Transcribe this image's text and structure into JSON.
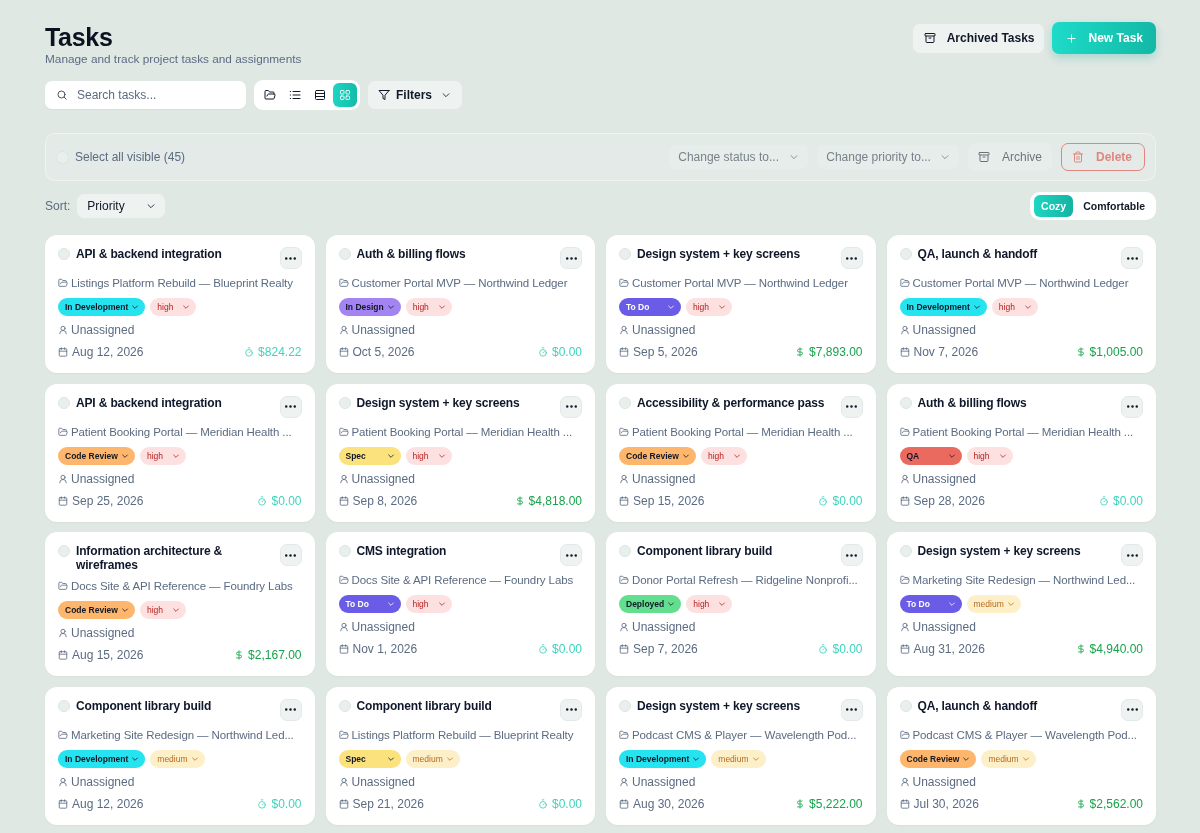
{
  "header": {
    "title": "Tasks",
    "subtitle": "Manage and track project tasks and assignments"
  },
  "header_actions": [
    {
      "label": "Archived Tasks",
      "kind": "secondary"
    },
    {
      "label": "New Task",
      "kind": "primary"
    }
  ],
  "toolbar": {
    "search": {
      "placeholder": "Search tasks..."
    },
    "view_modes": [
      {
        "selected": false
      },
      {
        "selected": false
      },
      {
        "selected": false
      },
      {
        "selected": true
      }
    ],
    "filters_label": "Filters"
  },
  "bulk_actions": {
    "select_all": {
      "label": "Select all visible (45)",
      "checked": false
    },
    "status_select": {
      "label": "Change status to...",
      "disabled": true
    },
    "priority_select": {
      "label": "Change priority to...",
      "disabled": true
    },
    "archive": {
      "label": "Archive",
      "disabled": true
    },
    "delete": {
      "label": "Delete",
      "disabled": true
    }
  },
  "sort": {
    "label": "Sort:",
    "value": "Priority"
  },
  "density": [
    {
      "label": "Cozy",
      "selected": true
    },
    {
      "label": "Comfortable",
      "selected": false
    }
  ],
  "tasks": [
    {
      "title": "API & backend integration",
      "checked": false,
      "project": "Listings Platform Rebuild — Blueprint Realty",
      "status": {
        "label": "In Development",
        "color": "#25e3ef"
      },
      "priority": {
        "label": "high",
        "color": "#fde1e1"
      },
      "assignee": "Unassigned",
      "due": "Aug 12, 2026",
      "amount": {
        "kind": "timer",
        "value": "$824.22"
      }
    },
    {
      "title": "Auth & billing flows",
      "checked": false,
      "project": "Customer Portal MVP — Northwind Ledger",
      "status": {
        "label": "In Design",
        "color": "#a384f2"
      },
      "priority": {
        "label": "high",
        "color": "#fde1e1"
      },
      "assignee": "Unassigned",
      "due": "Oct 5, 2026",
      "amount": {
        "kind": "timer",
        "value": "$0.00"
      }
    },
    {
      "title": "Design system + key screens",
      "checked": false,
      "project": "Customer Portal MVP — Northwind Ledger",
      "status": {
        "label": "To Do",
        "color": "#6b5ce7"
      },
      "priority": {
        "label": "high",
        "color": "#fde1e1"
      },
      "assignee": "Unassigned",
      "due": "Sep 5, 2026",
      "amount": {
        "kind": "budget",
        "value": "$7,893.00"
      }
    },
    {
      "title": "QA, launch & handoff",
      "checked": false,
      "project": "Customer Portal MVP — Northwind Ledger",
      "status": {
        "label": "In Development",
        "color": "#25e3ef"
      },
      "priority": {
        "label": "high",
        "color": "#fde1e1"
      },
      "assignee": "Unassigned",
      "due": "Nov 7, 2026",
      "amount": {
        "kind": "budget",
        "value": "$1,005.00"
      }
    },
    {
      "title": "API & backend integration",
      "checked": false,
      "project": "Patient Booking Portal — Meridian Health ...",
      "status": {
        "label": "Code Review",
        "color": "#fdb66b"
      },
      "priority": {
        "label": "high",
        "color": "#fde1e1"
      },
      "assignee": "Unassigned",
      "due": "Sep 25, 2026",
      "amount": {
        "kind": "timer",
        "value": "$0.00"
      }
    },
    {
      "title": "Design system + key screens",
      "checked": false,
      "project": "Patient Booking Portal — Meridian Health ...",
      "status": {
        "label": "Spec",
        "color": "#fbe27c"
      },
      "priority": {
        "label": "high",
        "color": "#fde1e1"
      },
      "assignee": "Unassigned",
      "due": "Sep 8, 2026",
      "amount": {
        "kind": "budget",
        "value": "$4,818.00"
      }
    },
    {
      "title": "Accessibility & performance pass",
      "checked": false,
      "project": "Patient Booking Portal — Meridian Health ...",
      "status": {
        "label": "Code Review",
        "color": "#fdb66b"
      },
      "priority": {
        "label": "high",
        "color": "#fde1e1"
      },
      "assignee": "Unassigned",
      "due": "Sep 15, 2026",
      "amount": {
        "kind": "timer",
        "value": "$0.00"
      }
    },
    {
      "title": "Auth & billing flows",
      "checked": false,
      "project": "Patient Booking Portal — Meridian Health ...",
      "status": {
        "label": "QA",
        "color": "#ea6a5f"
      },
      "priority": {
        "label": "high",
        "color": "#fde1e1"
      },
      "assignee": "Unassigned",
      "due": "Sep 28, 2026",
      "amount": {
        "kind": "timer",
        "value": "$0.00"
      }
    },
    {
      "title": "Information architecture & wireframes",
      "checked": false,
      "project": "Docs Site & API Reference — Foundry Labs",
      "status": {
        "label": "Code Review",
        "color": "#fdb66b"
      },
      "priority": {
        "label": "high",
        "color": "#fde1e1"
      },
      "assignee": "Unassigned",
      "due": "Aug 15, 2026",
      "amount": {
        "kind": "budget",
        "value": "$2,167.00"
      }
    },
    {
      "title": "CMS integration",
      "checked": false,
      "project": "Docs Site & API Reference — Foundry Labs",
      "status": {
        "label": "To Do",
        "color": "#6b5ce7"
      },
      "priority": {
        "label": "high",
        "color": "#fde1e1"
      },
      "assignee": "Unassigned",
      "due": "Nov 1, 2026",
      "amount": {
        "kind": "timer",
        "value": "$0.00"
      }
    },
    {
      "title": "Component library build",
      "checked": false,
      "project": "Donor Portal Refresh — Ridgeline Nonprofi...",
      "status": {
        "label": "Deployed",
        "color": "#63de8f"
      },
      "priority": {
        "label": "high",
        "color": "#fde1e1"
      },
      "assignee": "Unassigned",
      "due": "Sep 7, 2026",
      "amount": {
        "kind": "timer",
        "value": "$0.00"
      }
    },
    {
      "title": "Design system + key screens",
      "checked": false,
      "project": "Marketing Site Redesign — Northwind Led...",
      "status": {
        "label": "To Do",
        "color": "#6b5ce7"
      },
      "priority": {
        "label": "medium",
        "color": "#fdf0c8"
      },
      "assignee": "Unassigned",
      "due": "Aug 31, 2026",
      "amount": {
        "kind": "budget",
        "value": "$4,940.00"
      }
    },
    {
      "title": "Component library build",
      "checked": false,
      "project": "Marketing Site Redesign — Northwind Led...",
      "status": {
        "label": "In Development",
        "color": "#25e3ef"
      },
      "priority": {
        "label": "medium",
        "color": "#fdf0c8"
      },
      "assignee": "Unassigned",
      "due": "Aug 12, 2026",
      "amount": {
        "kind": "timer",
        "value": "$0.00"
      }
    },
    {
      "title": "Component library build",
      "checked": false,
      "project": "Listings Platform Rebuild — Blueprint Realty",
      "status": {
        "label": "Spec",
        "color": "#fbe27c"
      },
      "priority": {
        "label": "medium",
        "color": "#fdf0c8"
      },
      "assignee": "Unassigned",
      "due": "Sep 21, 2026",
      "amount": {
        "kind": "timer",
        "value": "$0.00"
      }
    },
    {
      "title": "Design system + key screens",
      "checked": false,
      "project": "Podcast CMS & Player — Wavelength Pod...",
      "status": {
        "label": "In Development",
        "color": "#25e3ef"
      },
      "priority": {
        "label": "medium",
        "color": "#fdf0c8"
      },
      "assignee": "Unassigned",
      "due": "Aug 30, 2026",
      "amount": {
        "kind": "budget",
        "value": "$5,222.00"
      }
    },
    {
      "title": "QA, launch & handoff",
      "checked": false,
      "project": "Podcast CMS & Player — Wavelength Pod...",
      "status": {
        "label": "Code Review",
        "color": "#fdb66b"
      },
      "priority": {
        "label": "medium",
        "color": "#fdf0c8"
      },
      "assignee": "Unassigned",
      "due": "Jul 30, 2026",
      "amount": {
        "kind": "budget",
        "value": "$2,562.00"
      }
    }
  ]
}
